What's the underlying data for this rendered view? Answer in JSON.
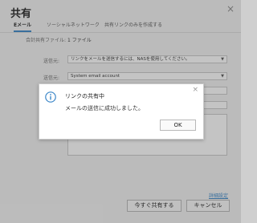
{
  "window": {
    "title": "共有",
    "close_label": "×"
  },
  "tabs": [
    {
      "label": "Eメール",
      "active": true
    },
    {
      "label": "ソーシャルネットワーク",
      "active": false
    },
    {
      "label": "共有リンクのみを作成する",
      "active": false
    }
  ],
  "form": {
    "shared_files_label": "合計共有ファイル:",
    "shared_files_value": "1 ファイル",
    "sender_label": "送信元:",
    "sender_value": "リンクをメールを送信するには、NASを使用してください。",
    "from_label": "送信元:",
    "from_value": "System email account"
  },
  "footer": {
    "advanced_link": "詳細設定",
    "share_now_button": "今すぐ共有する",
    "cancel_button": "キャンセル"
  },
  "dialog": {
    "title": "リンクの共有中",
    "message": "メールの送信に成功しました。",
    "ok_button": "OK",
    "close_label": "×",
    "icon": "info-icon"
  },
  "colors": {
    "accent": "#3a86c8",
    "icon": "#3a86c8"
  }
}
